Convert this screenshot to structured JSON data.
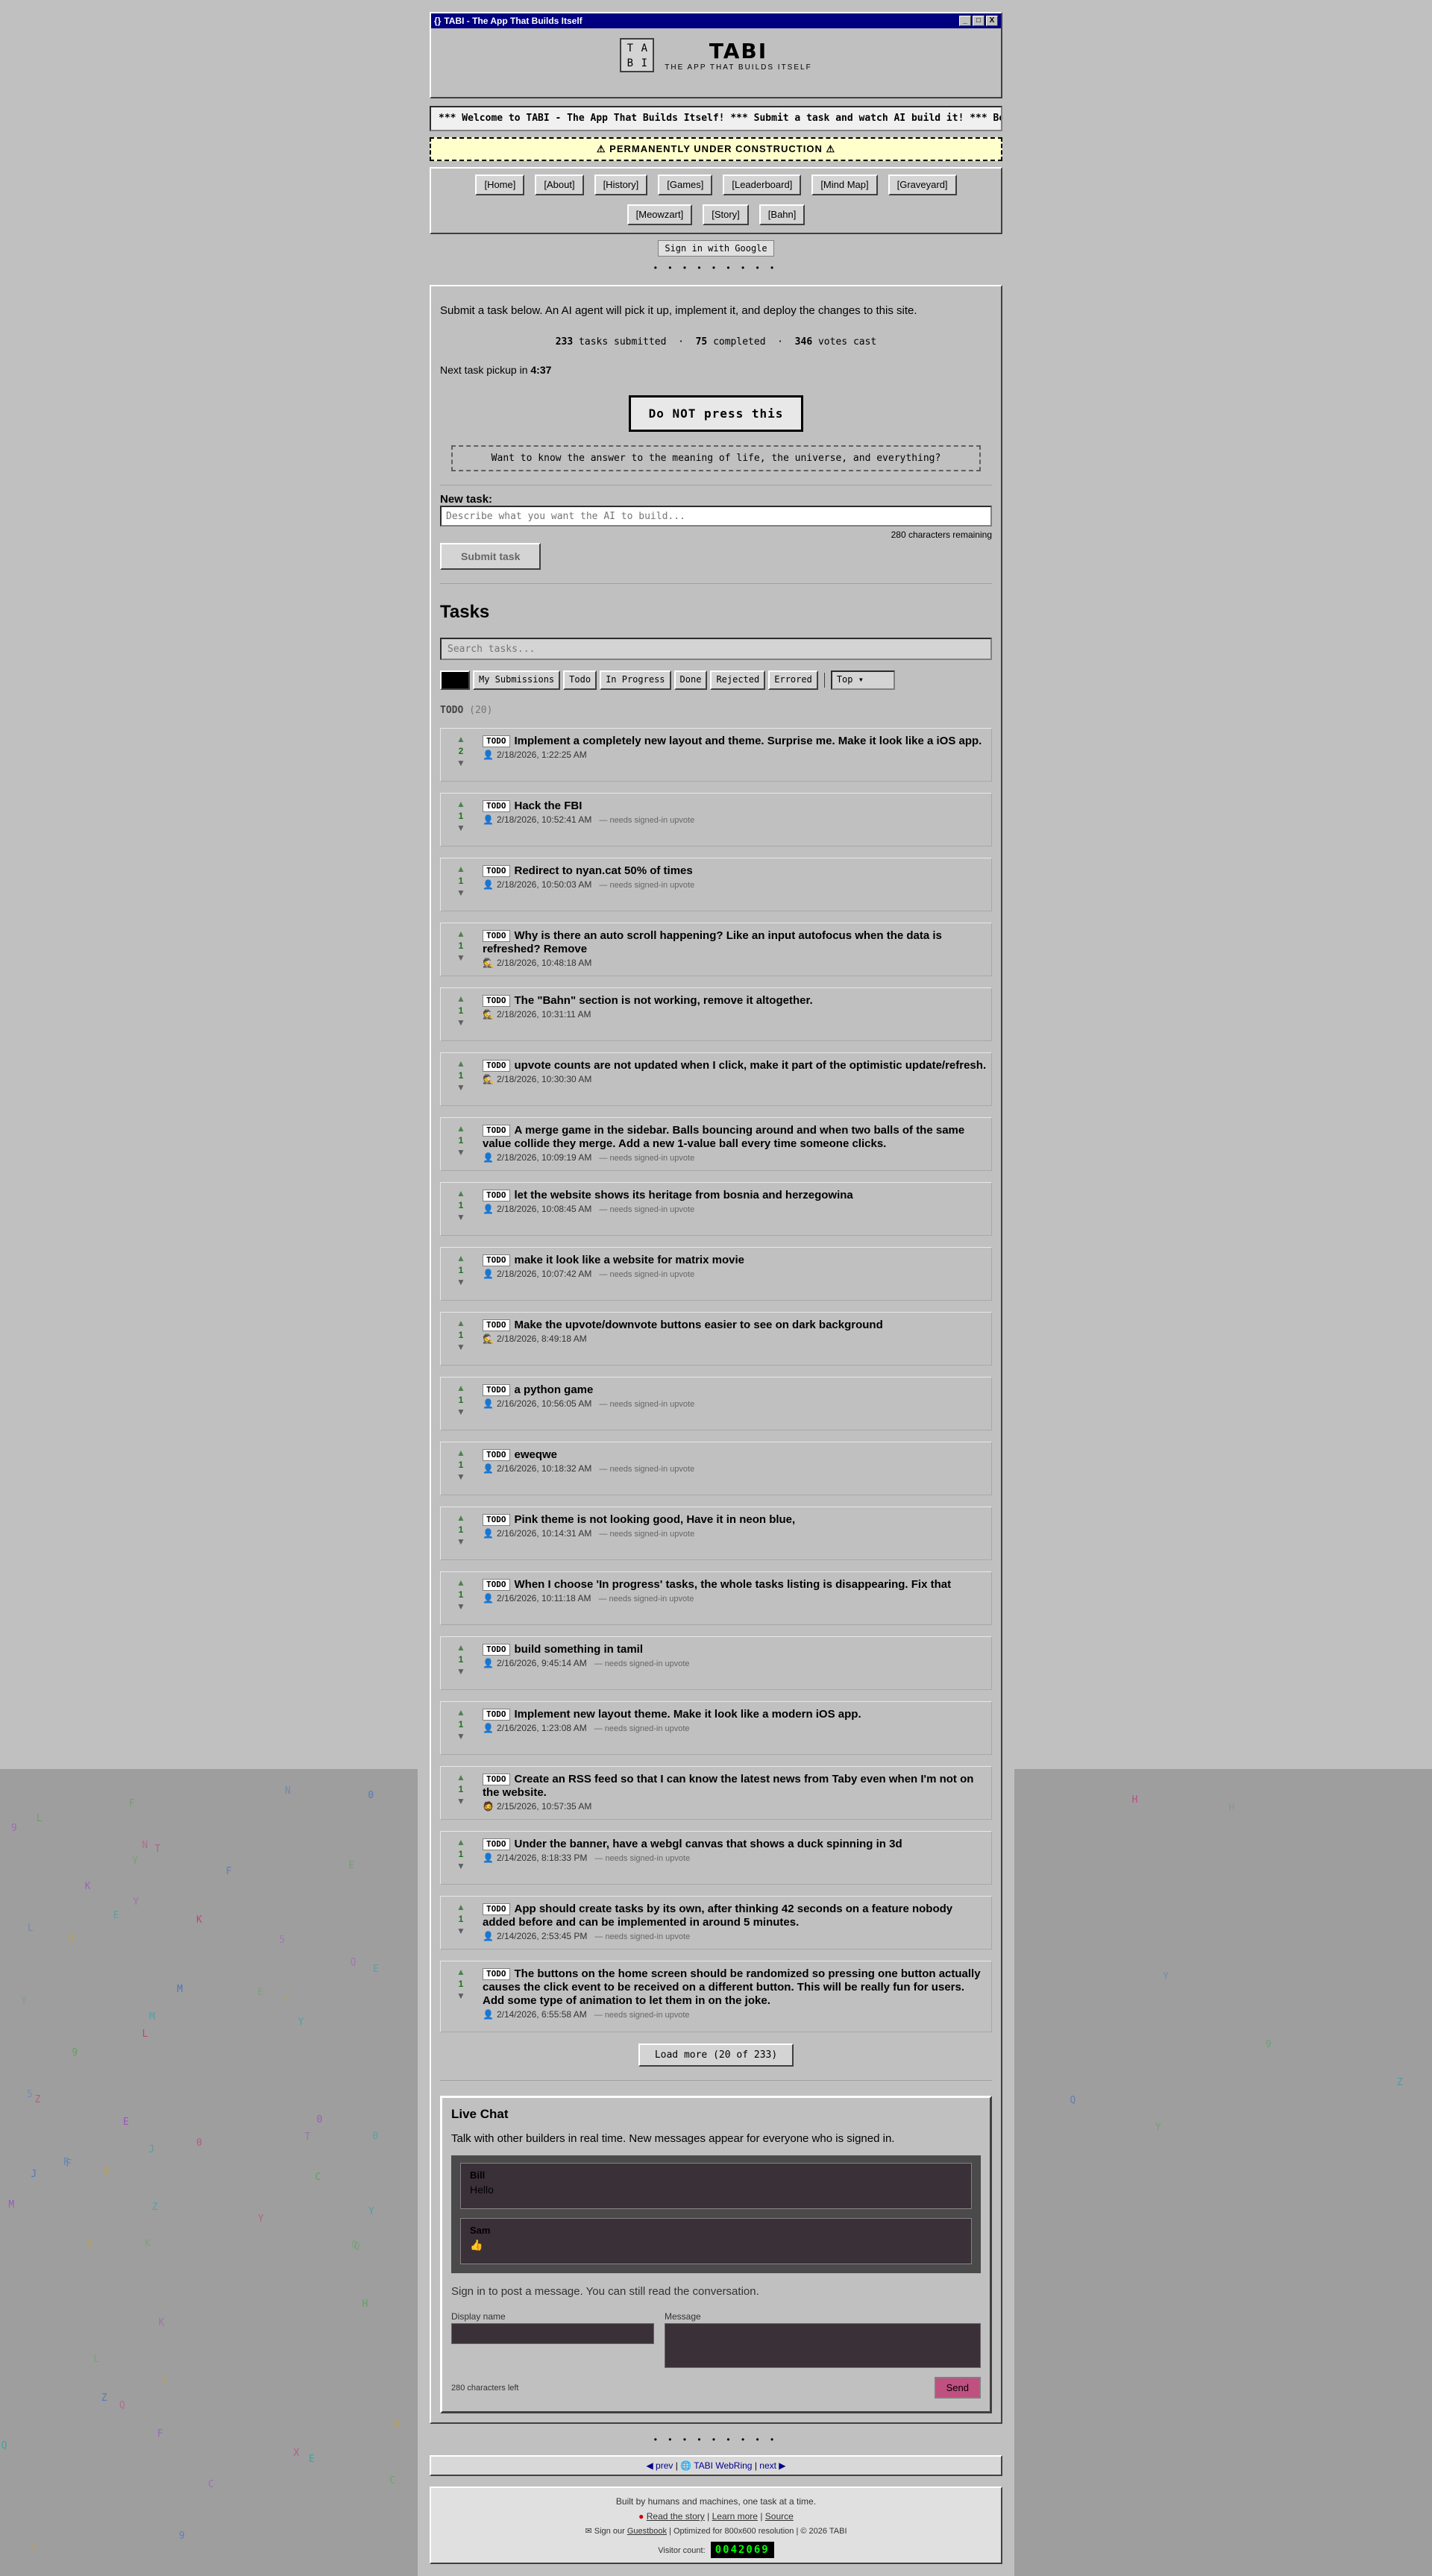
{
  "window": {
    "title": "TABI - The App That Builds Itself",
    "icon": "{}",
    "minimize": "_",
    "maximize": "□",
    "close": "X"
  },
  "brand": {
    "logo": [
      "T",
      "A",
      "B",
      "I"
    ],
    "name": "TABI",
    "tagline": "THE APP THAT BUILDS ITSELF"
  },
  "marquee": "*** Welcome to TABI - The App That Builds Itself! *** Submit a task and watch AI build it! *** Best view",
  "construction": "⚠ PERMANENTLY UNDER CONSTRUCTION ⚠",
  "nav": {
    "row1": [
      "[Home]",
      "[About]",
      "[History]",
      "[Games]",
      "[Leaderboard]",
      "[Mind Map]",
      "[Graveyard]"
    ],
    "row2": [
      "[Meowzart]",
      "[Story]",
      "[Bahn]"
    ]
  },
  "signin": "Sign in with Google",
  "dots": "• • • • • • • • •",
  "intro": "Submit a task below. An AI agent will pick it up, implement it, and deploy the changes to this site.",
  "stats": {
    "submitted_n": "233",
    "submitted_l": "tasks submitted",
    "completed_n": "75",
    "completed_l": "completed",
    "votes_n": "346",
    "votes_l": "votes cast"
  },
  "pickup": {
    "label": "Next task pickup in",
    "time": "4:37"
  },
  "donot": "Do NOT press this",
  "meaning": "Want to know the answer to the meaning of life, the universe, and everything?",
  "newtask": {
    "label": "New task:",
    "placeholder": "Describe what you want the AI to build...",
    "remaining": "280 characters remaining",
    "submit": "Submit task"
  },
  "tasks": {
    "heading": "Tasks",
    "search_placeholder": "Search tasks...",
    "filters": [
      "My Submissions",
      "Todo",
      "In Progress",
      "Done",
      "Rejected",
      "Errored"
    ],
    "sort": "Top",
    "section": "TODO",
    "section_count": "(20)",
    "tag": "TODO",
    "needs": "— needs signed-in upvote",
    "up": "▲",
    "down": "▼",
    "items": [
      {
        "votes": "2",
        "title": "Implement a completely new layout and theme. Surprise me. Make it look like a iOS app.",
        "icon": "👤",
        "date": "2/18/2026, 1:22:25 AM",
        "needs": false,
        "tall": false
      },
      {
        "votes": "1",
        "title": "Hack the FBI",
        "icon": "👤",
        "date": "2/18/2026, 10:52:41 AM",
        "needs": true,
        "tall": false
      },
      {
        "votes": "1",
        "title": "Redirect to nyan.cat 50% of times",
        "icon": "👤",
        "date": "2/18/2026, 10:50:03 AM",
        "needs": true,
        "tall": false
      },
      {
        "votes": "1",
        "title": "Why is there an auto scroll happening? Like an input autofocus when the data is refreshed? Remove",
        "icon": "🕵",
        "date": "2/18/2026, 10:48:18 AM",
        "needs": false,
        "tall": false
      },
      {
        "votes": "1",
        "title": "The \"Bahn\" section is not working, remove it altogether.",
        "icon": "🕵",
        "date": "2/18/2026, 10:31:11 AM",
        "needs": false,
        "tall": false
      },
      {
        "votes": "1",
        "title": "upvote counts are not updated when I click, make it part of the optimistic update/refresh.",
        "icon": "🕵",
        "date": "2/18/2026, 10:30:30 AM",
        "needs": false,
        "tall": false
      },
      {
        "votes": "1",
        "title": "A merge game in the sidebar. Balls bouncing around and when two balls of the same value collide they merge. Add a new 1-value ball every time someone clicks.",
        "icon": "👤",
        "date": "2/18/2026, 10:09:19 AM",
        "needs": true,
        "tall": false
      },
      {
        "votes": "1",
        "title": "let the website shows its heritage from bosnia and herzegowina",
        "icon": "👤",
        "date": "2/18/2026, 10:08:45 AM",
        "needs": true,
        "tall": false
      },
      {
        "votes": "1",
        "title": "make it look like a website for matrix movie",
        "icon": "👤",
        "date": "2/18/2026, 10:07:42 AM",
        "needs": true,
        "tall": false
      },
      {
        "votes": "1",
        "title": "Make the upvote/downvote buttons easier to see on dark background",
        "icon": "🕵",
        "date": "2/18/2026, 8:49:18 AM",
        "needs": false,
        "tall": false
      },
      {
        "votes": "1",
        "title": "a python game",
        "icon": "👤",
        "date": "2/16/2026, 10:56:05 AM",
        "needs": true,
        "tall": false
      },
      {
        "votes": "1",
        "title": "eweqwe",
        "icon": "👤",
        "date": "2/16/2026, 10:18:32 AM",
        "needs": true,
        "tall": false
      },
      {
        "votes": "1",
        "title": "Pink theme is not looking good, Have it in neon blue,",
        "icon": "👤",
        "date": "2/16/2026, 10:14:31 AM",
        "needs": true,
        "tall": false
      },
      {
        "votes": "1",
        "title": "When I choose 'In progress' tasks, the whole tasks listing is disappearing. Fix that",
        "icon": "👤",
        "date": "2/16/2026, 10:11:18 AM",
        "needs": true,
        "tall": false
      },
      {
        "votes": "1",
        "title": "build something in tamil",
        "icon": "👤",
        "date": "2/16/2026, 9:45:14 AM",
        "needs": true,
        "tall": false
      },
      {
        "votes": "1",
        "title": "Implement new layout theme. Make it look like a modern iOS app.",
        "icon": "👤",
        "date": "2/16/2026, 1:23:08 AM",
        "needs": true,
        "tall": false
      },
      {
        "votes": "1",
        "title": "Create an RSS feed so that I can know the latest news from Taby even when I'm not on the website.",
        "icon": "🧔",
        "date": "2/15/2026, 10:57:35 AM",
        "needs": false,
        "tall": false
      },
      {
        "votes": "1",
        "title": "Under the banner, have a webgl canvas that shows a duck spinning in 3d",
        "icon": "👤",
        "date": "2/14/2026, 8:18:33 PM",
        "needs": true,
        "tall": false
      },
      {
        "votes": "1",
        "title": "App should create tasks by its own, after thinking 42 seconds on a feature nobody added before and can be implemented in around 5 minutes.",
        "icon": "👤",
        "date": "2/14/2026, 2:53:45 PM",
        "needs": true,
        "tall": false
      },
      {
        "votes": "1",
        "title": "The buttons on the home screen should be randomized so pressing one button actually causes the click event to be received on a different button. This will be really fun for users. Add some type of animation to let them in on the joke.",
        "icon": "👤",
        "date": "2/14/2026, 6:55:58 AM",
        "needs": true,
        "tall": true
      }
    ],
    "load_more": "Load more (20 of 233)"
  },
  "chat": {
    "heading": "Live Chat",
    "sub": "Talk with other builders in real time. New messages appear for everyone who is signed in.",
    "messages": [
      {
        "author": "Bill",
        "text": "Hello"
      },
      {
        "author": "Sam",
        "text": "👍"
      }
    ],
    "note": "Sign in to post a message. You can still read the conversation.",
    "name_label": "Display name",
    "msg_label": "Message",
    "chars_left": "280 characters left",
    "send": "Send"
  },
  "dots2": "• • • • • • • • •",
  "webring": {
    "prev": "◀ prev",
    "sep1": " | ",
    "name": "🌐 TABI WebRing",
    "sep2": " | ",
    "next": "next ▶"
  },
  "footer": {
    "line1": "Built by humans and machines, one task at a time.",
    "bullet": "●",
    "story": "Read the story",
    "sep": " | ",
    "learn": "Learn more",
    "source": "Source",
    "guest_pre": "✉ Sign our ",
    "guestbook": "Guestbook",
    "guest_post": " | Optimized for 800x600 resolution | © 2026 TABI",
    "visitor_label": "Visitor count:",
    "visitor_count": "0042069"
  },
  "matrix_chars": [
    "Q",
    "0",
    "M",
    "J",
    "E",
    "X",
    "N",
    "Y",
    "Z",
    "5",
    "F",
    "9",
    "L",
    "H",
    "C",
    "Q",
    "Y",
    "E",
    "T",
    "K"
  ]
}
